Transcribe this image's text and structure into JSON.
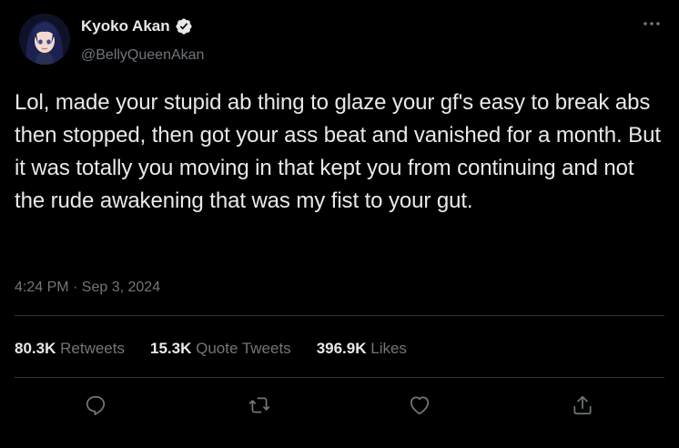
{
  "author": {
    "display_name": "Kyoko Akan",
    "handle": "@BellyQueenAkan",
    "verified": true,
    "avatar_icon": "anime-character-avatar"
  },
  "tweet": {
    "text": "Lol, made your stupid ab thing to glaze your gf's easy to break abs then stopped, then got your ass beat and vanished for a month. But it was totally you moving in that kept you from continuing and not the rude awakening that was my fist to your gut.",
    "timestamp": "4:24 PM · Sep 3, 2024"
  },
  "stats": {
    "retweets_count": "80.3K",
    "retweets_label": "Retweets",
    "quotes_count": "15.3K",
    "quotes_label": "Quote Tweets",
    "likes_count": "396.9K",
    "likes_label": "Likes"
  },
  "actions": [
    "reply-icon",
    "retweet-icon",
    "like-icon",
    "share-icon"
  ],
  "colors": {
    "background": "#000000",
    "text_primary": "#e7e9ea",
    "text_secondary": "#71767b",
    "divider": "#2f3336"
  }
}
